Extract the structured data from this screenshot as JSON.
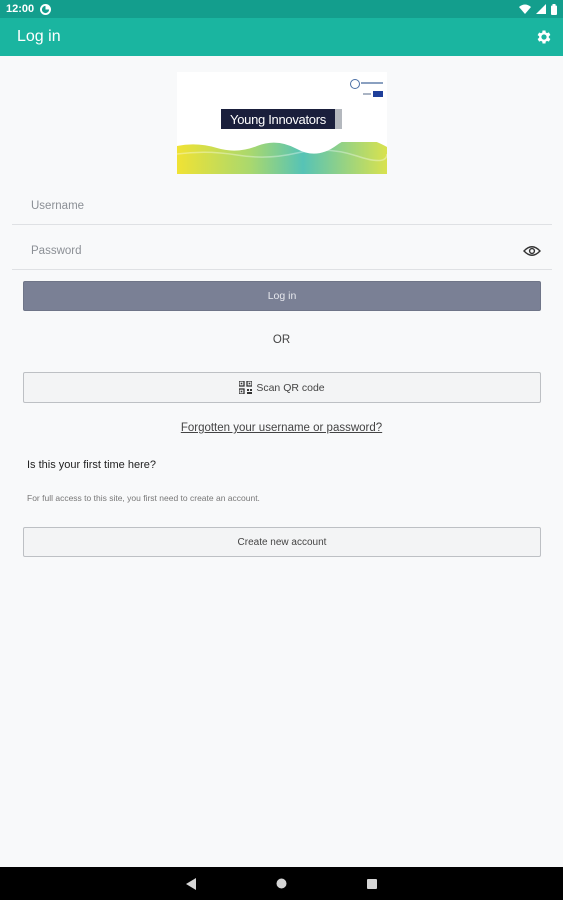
{
  "status": {
    "time": "12:00"
  },
  "header": {
    "title": "Log in"
  },
  "logo": {
    "text": "Young Innovators"
  },
  "form": {
    "username_placeholder": "Username",
    "password_placeholder": "Password",
    "login_label": "Log in",
    "or_text": "OR",
    "scan_qr_label": "Scan QR code",
    "forgot_link": "Forgotten your username or password?"
  },
  "signup": {
    "heading": "Is this your first time here?",
    "description": "For full access to this site, you first need to create an account.",
    "create_label": "Create new account"
  },
  "colors": {
    "status_bar": "#139e8d",
    "app_bar": "#1ab5a0",
    "primary_button": "#7a8095",
    "background": "#f8f9fa"
  },
  "icons": {
    "settings": "gear-icon",
    "password_toggle": "eye-icon",
    "qr": "qr-code-icon",
    "nav_back": "back-triangle-icon",
    "nav_home": "home-circle-icon",
    "nav_recents": "recents-square-icon"
  }
}
